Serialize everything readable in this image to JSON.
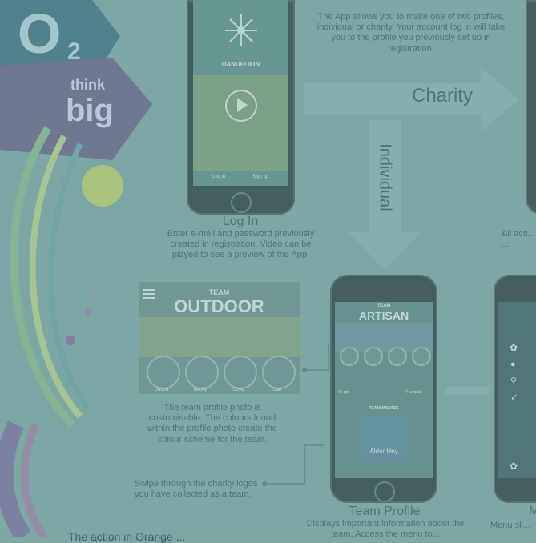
{
  "logo": {
    "o2": "O",
    "o2_sub": "2",
    "think": "think",
    "big": "big"
  },
  "intro_text": "The App allows you to make one of two profiles, individual or charity.  Your account log in will take you to the profile you previously set up in registration.",
  "arrows": {
    "charity": "Charity",
    "individual": "Individual"
  },
  "login_phone": {
    "app_name": "DANDELION",
    "bottom_left": "Log in",
    "bottom_right": "Sign up"
  },
  "login_caption": {
    "title": "Log In",
    "body": "Enter e-mail and password previously created in registration.  Video can be played to see a preview of the App."
  },
  "right_caption": {
    "body": "All acti... the ..."
  },
  "team_outdoor": {
    "team_label": "TEAM",
    "team_name": "OUTDOOR",
    "members": [
      "Jason",
      "Becky",
      "Olivia",
      "Carl"
    ]
  },
  "team_photo_caption": "The team profile photo is customisable.  The colours found within the profile photo create the colour scheme for the team.",
  "swipe_caption": "Swipe through the charity logos you have collected as a team.",
  "team_profile_phone": {
    "team_label": "TEAM",
    "team_name": "ARTISAN",
    "awards_label": "TEAM AWARDS",
    "award_name": "Alder Hey",
    "stat_left": "46 pts",
    "stat_right": "7 awards"
  },
  "team_profile_caption": {
    "title": "Team Profile",
    "body": "Displays important information about the team.  Access the menu to..."
  },
  "menu_caption": {
    "title": "M",
    "body": "Menu sli..."
  },
  "bottom_partial": "The action in Orange ..."
}
